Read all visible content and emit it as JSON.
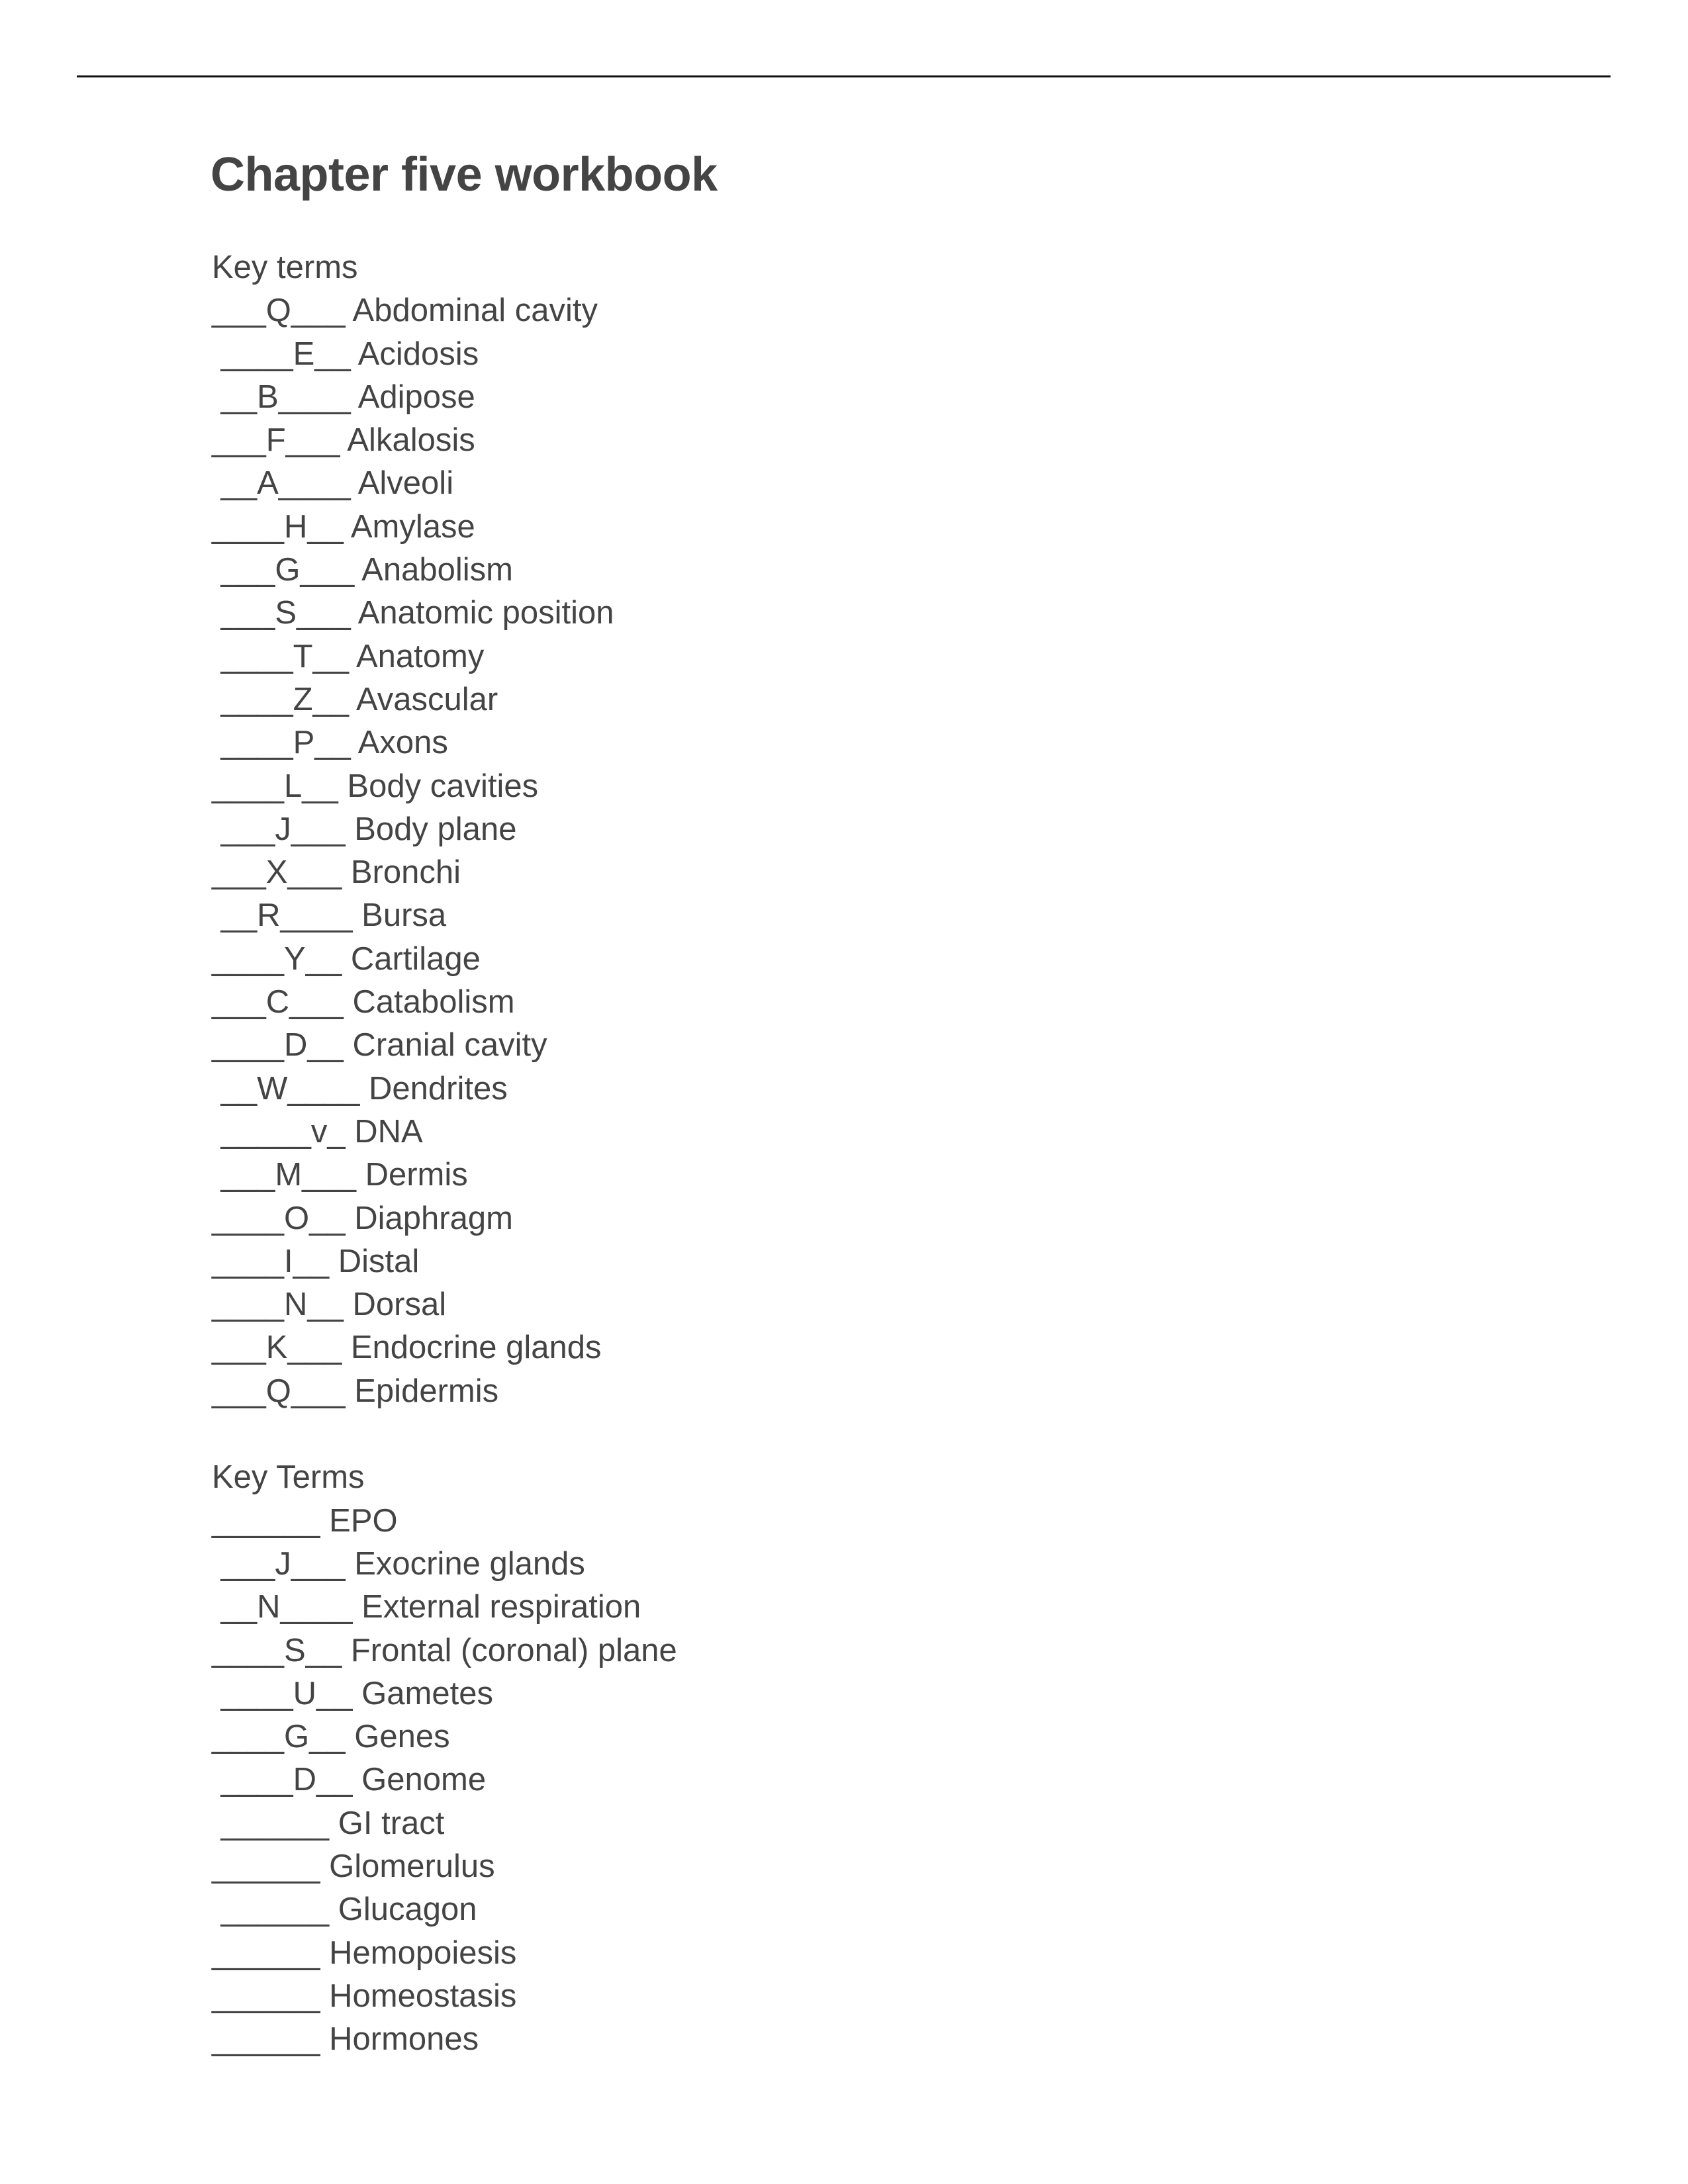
{
  "document": {
    "title": "Chapter five workbook",
    "sections": [
      {
        "heading": "Key terms",
        "items": [
          {
            "blank": "___Q___",
            "term": "Abdominal cavity"
          },
          {
            "blank": " ____E__",
            "term": "Acidosis"
          },
          {
            "blank": " __B____",
            "term": "Adipose"
          },
          {
            "blank": "___F___",
            "term": "Alkalosis"
          },
          {
            "blank": " __A____",
            "term": "Alveoli"
          },
          {
            "blank": "____H__",
            "term": "Amylase"
          },
          {
            "blank": " ___G___",
            "term": "Anabolism"
          },
          {
            "blank": " ___S___",
            "term": "Anatomic position"
          },
          {
            "blank": " ____T__",
            "term": "Anatomy"
          },
          {
            "blank": " ____Z__",
            "term": "Avascular"
          },
          {
            "blank": " ____P__",
            "term": "Axons"
          },
          {
            "blank": "____L__",
            "term": "Body cavities"
          },
          {
            "blank": " ___J___",
            "term": "Body plane"
          },
          {
            "blank": "___X___",
            "term": "Bronchi"
          },
          {
            "blank": " __R____",
            "term": "Bursa"
          },
          {
            "blank": "____Y__",
            "term": "Cartilage"
          },
          {
            "blank": "___C___",
            "term": "Catabolism"
          },
          {
            "blank": "____D__",
            "term": "Cranial cavity"
          },
          {
            "blank": " __W____",
            "term": "Dendrites"
          },
          {
            "blank": " _____v_",
            "term": "DNA"
          },
          {
            "blank": " ___M___",
            "term": "Dermis"
          },
          {
            "blank": "____O__",
            "term": "Diaphragm"
          },
          {
            "blank": "____I__",
            "term": "Distal"
          },
          {
            "blank": "____N__",
            "term": "Dorsal"
          },
          {
            "blank": "___K___",
            "term": "Endocrine glands"
          },
          {
            "blank": "___Q___",
            "term": "Epidermis"
          }
        ]
      },
      {
        "heading": "Key Terms",
        "items": [
          {
            "blank": "______",
            "term": "EPO"
          },
          {
            "blank": " ___J___",
            "term": "Exocrine glands"
          },
          {
            "blank": " __N____",
            "term": "External respiration"
          },
          {
            "blank": "____S__",
            "term": "Frontal (coronal) plane"
          },
          {
            "blank": " ____U__",
            "term": "Gametes"
          },
          {
            "blank": "____G__",
            "term": "Genes"
          },
          {
            "blank": " ____D__",
            "term": "Genome"
          },
          {
            "blank": " ______",
            "term": "GI tract"
          },
          {
            "blank": "______",
            "term": "Glomerulus"
          },
          {
            "blank": " ______",
            "term": "Glucagon"
          },
          {
            "blank": "______",
            "term": "Hemopoiesis"
          },
          {
            "blank": "______",
            "term": "Homeostasis"
          },
          {
            "blank": "______",
            "term": "Hormones"
          }
        ]
      }
    ]
  }
}
